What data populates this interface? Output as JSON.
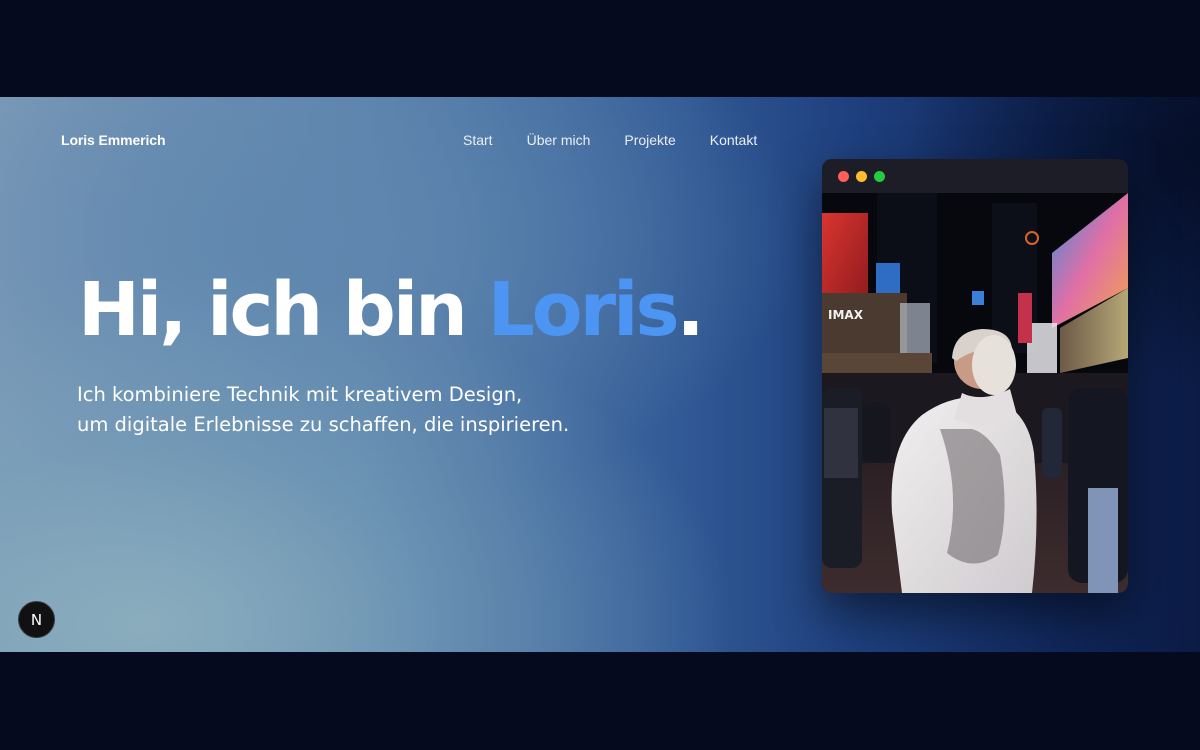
{
  "nav": {
    "brand": "Loris Emmerich",
    "items": [
      {
        "label": "Start"
      },
      {
        "label": "Über mich"
      },
      {
        "label": "Projekte"
      },
      {
        "label": "Kontakt"
      }
    ]
  },
  "hero": {
    "headline_prefix": "Hi, ich bin ",
    "headline_name": "Loris",
    "headline_suffix": ".",
    "subtitle_line1": "Ich kombiniere Technik mit kreativem Design,",
    "subtitle_line2": "um digitale Erlebnisse zu schaffen, die inspirieren."
  },
  "badge": {
    "letter": "N",
    "icon": "nextjs-logo-icon"
  },
  "window": {
    "controls": [
      "close",
      "minimize",
      "maximize"
    ],
    "photo": {
      "subject": "photo-of-person-in-white-hoodie-at-times-square",
      "billboard_text": "IMAX"
    }
  },
  "colors": {
    "accent": "#4c95f3",
    "page_background": "#050a1f",
    "window_background": "#1c1d26"
  }
}
